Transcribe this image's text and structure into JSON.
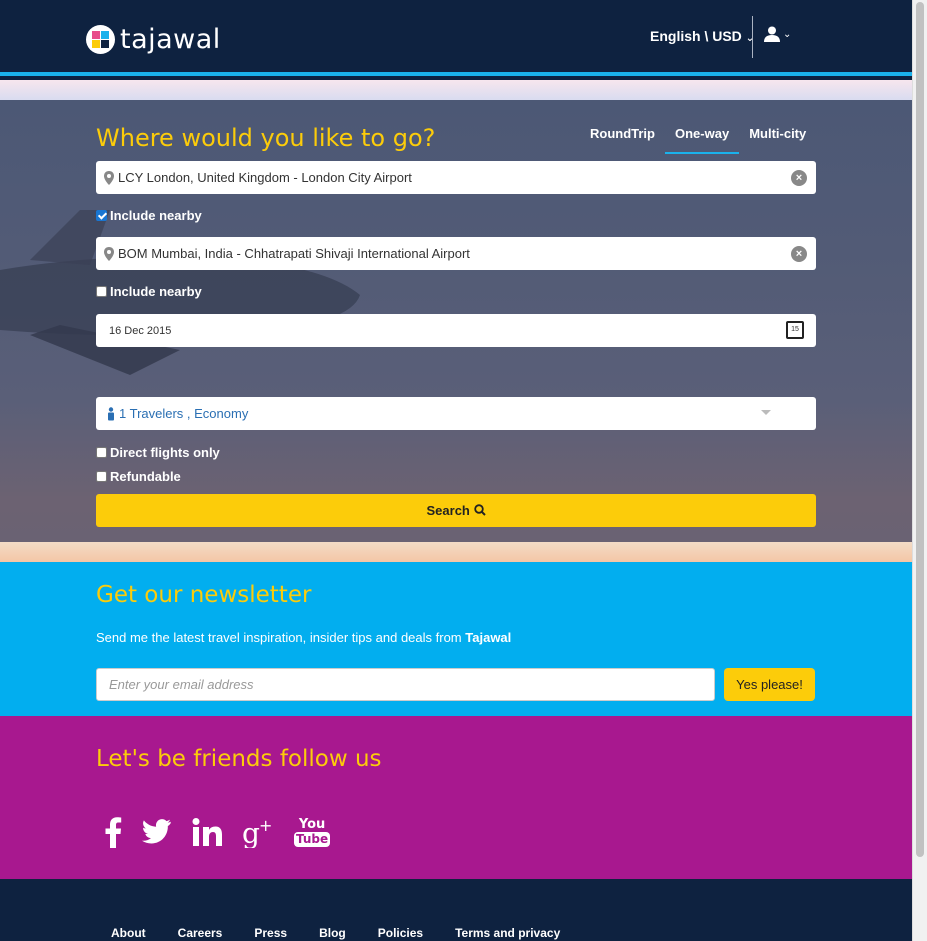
{
  "header": {
    "logo_text": "tajawal",
    "language_currency": "English \\ USD",
    "user_icon": "user-icon"
  },
  "search": {
    "heading": "Where would you like to go?",
    "tabs": [
      {
        "label": "RoundTrip",
        "active": false
      },
      {
        "label": "One-way",
        "active": true
      },
      {
        "label": "Multi-city",
        "active": false
      }
    ],
    "origin": "LCY London, United Kingdom - London City Airport",
    "origin_nearby_label": "Include nearby",
    "origin_nearby_checked": true,
    "destination": "BOM Mumbai, India - Chhatrapati Shivaji International Airport",
    "destination_nearby_label": "Include nearby",
    "destination_nearby_checked": false,
    "date": "16 Dec 2015",
    "calendar_day": "15",
    "travelers": "1 Travelers , Economy",
    "direct_label": "Direct flights only",
    "refundable_label": "Refundable",
    "search_label": "Search"
  },
  "newsletter": {
    "title": "Get our newsletter",
    "text": "Send me the latest travel inspiration, insider tips and deals from",
    "brand": "Tajawal",
    "email_placeholder": "Enter your email address",
    "button_label": "Yes please!"
  },
  "social": {
    "title": "Let's be friends follow us",
    "icons": [
      "facebook-icon",
      "twitter-icon",
      "linkedin-icon",
      "google-plus-icon",
      "youtube-icon"
    ],
    "youtube_top": "You",
    "youtube_bottom": "Tube"
  },
  "footer": {
    "links": [
      "About",
      "Careers",
      "Press",
      "Blog",
      "Policies",
      "Terms and privacy"
    ]
  },
  "colors": {
    "navy": "#0e2240",
    "accent_blue": "#02aeef",
    "yellow": "#fccc0a",
    "magenta": "#a8188f"
  }
}
